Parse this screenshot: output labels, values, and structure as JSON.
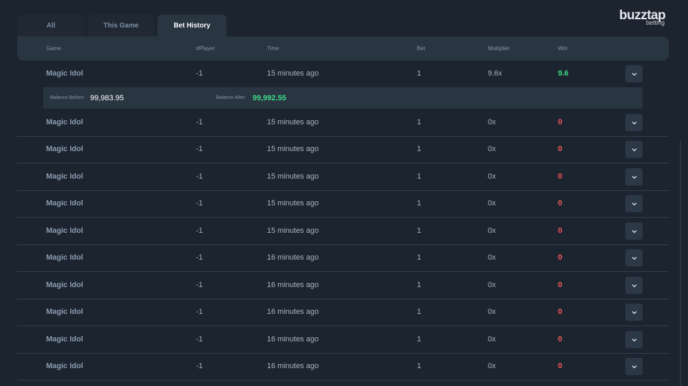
{
  "tabs": [
    {
      "label": "All",
      "active": false
    },
    {
      "label": "This Game",
      "active": false
    },
    {
      "label": "Bet History",
      "active": true
    }
  ],
  "brand": {
    "name": "buzztap",
    "sub": "betting"
  },
  "columns": [
    "Game",
    "#Player",
    "Time",
    "Bet",
    "Multiplier",
    "Win"
  ],
  "rows": [
    {
      "game": "Magic Idol",
      "player": "-1",
      "time": "15 minutes ago",
      "bet": "1",
      "multiplier": "9.6x",
      "win": "9.6",
      "expanded": true
    },
    {
      "game": "Magic Idol",
      "player": "-1",
      "time": "15 minutes ago",
      "bet": "1",
      "multiplier": "0x",
      "win": "0"
    },
    {
      "game": "Magic Idol",
      "player": "-1",
      "time": "15 minutes ago",
      "bet": "1",
      "multiplier": "0x",
      "win": "0"
    },
    {
      "game": "Magic Idol",
      "player": "-1",
      "time": "15 minutes ago",
      "bet": "1",
      "multiplier": "0x",
      "win": "0"
    },
    {
      "game": "Magic Idol",
      "player": "-1",
      "time": "15 minutes ago",
      "bet": "1",
      "multiplier": "0x",
      "win": "0"
    },
    {
      "game": "Magic Idol",
      "player": "-1",
      "time": "15 minutes ago",
      "bet": "1",
      "multiplier": "0x",
      "win": "0"
    },
    {
      "game": "Magic Idol",
      "player": "-1",
      "time": "16 minutes ago",
      "bet": "1",
      "multiplier": "0x",
      "win": "0"
    },
    {
      "game": "Magic Idol",
      "player": "-1",
      "time": "16 minutes ago",
      "bet": "1",
      "multiplier": "0x",
      "win": "0"
    },
    {
      "game": "Magic Idol",
      "player": "-1",
      "time": "16 minutes ago",
      "bet": "1",
      "multiplier": "0x",
      "win": "0"
    },
    {
      "game": "Magic Idol",
      "player": "-1",
      "time": "16 minutes ago",
      "bet": "1",
      "multiplier": "0x",
      "win": "0"
    },
    {
      "game": "Magic Idol",
      "player": "-1",
      "time": "16 minutes ago",
      "bet": "1",
      "multiplier": "0x",
      "win": "0"
    }
  ],
  "expanded_details": {
    "balance_before_label": "Balance Before:",
    "balance_before": "99,983.95",
    "balance_after_label": "Balance After:",
    "balance_after": "99,992.55"
  },
  "colors": {
    "win_positive": "#3ddc84",
    "win_zero": "#ff5a5a",
    "accent": "#2a3542"
  },
  "icons": {
    "row_toggle": "chevron-down-icon"
  }
}
